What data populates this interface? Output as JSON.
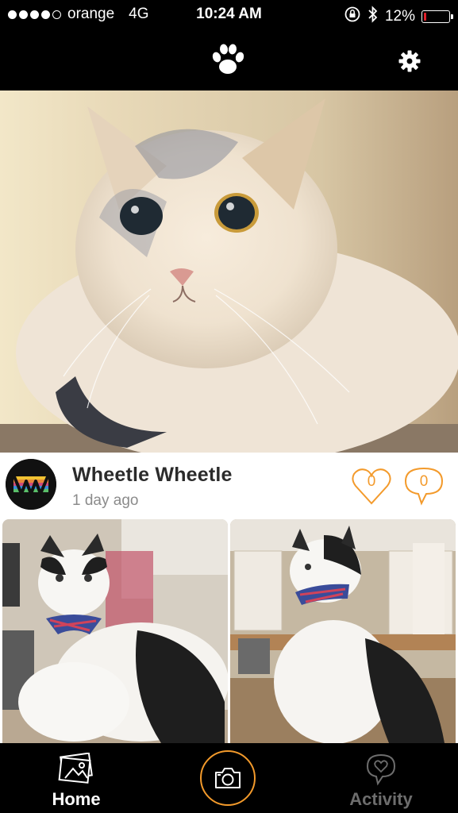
{
  "status_bar": {
    "carrier": "orange",
    "network": "4G",
    "time": "10:24 AM",
    "battery": "12%",
    "battery_level": 0.12,
    "signal_bars_filled": 4,
    "signal_bars_total": 5
  },
  "nav": {
    "logo_icon": "paw-icon",
    "settings_icon": "gear-icon"
  },
  "post": {
    "username": "Wheetle Wheetle",
    "time_ago": "1 day ago",
    "likes": "0",
    "comments": "0"
  },
  "tabs": {
    "home_label": "Home",
    "activity_label": "Activity"
  },
  "colors": {
    "accent": "#f39a2b",
    "battery_low": "#e0202a"
  }
}
